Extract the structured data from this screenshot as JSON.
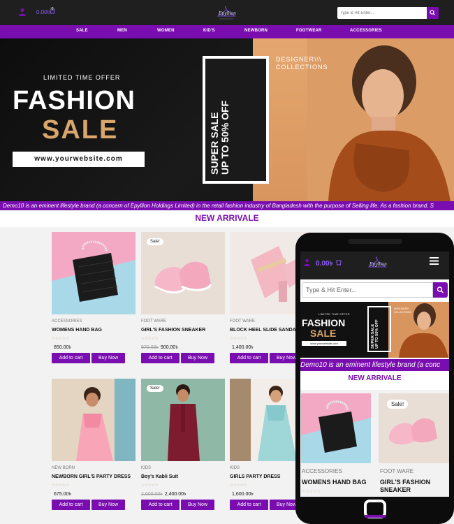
{
  "header": {
    "cart_amount": "0.00৳",
    "cart_count": "0",
    "search_placeholder": "Type & Hit Enter..."
  },
  "nav": {
    "items": [
      "SALE",
      "MEN",
      "WOMEN",
      "KID'S",
      "NEWBORN",
      "FOOTWEAR",
      "ACCESSORIES"
    ]
  },
  "hero": {
    "offer": "LIMITED TIME OFFER",
    "title1": "FASHION",
    "title2": "SALE",
    "url": "www.yourwebsite.com",
    "vertical_line1": "SUPER SALE",
    "vertical_line2": "UP TO 50% OFF",
    "designer_line1": "DESIGNER\\\\\\",
    "designer_line2": "COLLECTIONS"
  },
  "ticker": "Demo10 is an eminent lifestyle brand (a concern of Epyllion Holdings Limited) in the retail fashion industry of Bangladesh with the purpose of Selling life. As a fashion brand, S",
  "section_title": "NEW ARRIVALE",
  "products": [
    {
      "category": "ACCESSORIES",
      "name": "WOMENS HAND BAG",
      "stars": "☆☆☆☆☆",
      "old_price": "",
      "price": "850.00৳",
      "sale": "",
      "cart_label": "Add to cart",
      "buy_label": "Buy Now"
    },
    {
      "category": "FOOT WARE",
      "name": "GIRL'S FASHION SNEAKER",
      "stars": "☆☆☆☆☆",
      "old_price": "970.00৳",
      "price": "900.00৳",
      "sale": "Sale!",
      "cart_label": "Add to cart",
      "buy_label": "Buy Now"
    },
    {
      "category": "FOOT WARE",
      "name": "BLOCK HEEL SLIDE SANDAL",
      "stars": "☆☆☆☆☆",
      "old_price": "",
      "price": "1,400.00৳",
      "sale": "",
      "cart_label": "Add to cart",
      "buy_label": "Buy Now"
    },
    {
      "category": "NEW BORN",
      "name": "NEWBORN GIRL'S PARTY DRESS",
      "stars": "☆☆☆☆☆",
      "old_price": "",
      "price": "675.00৳",
      "sale": "",
      "cart_label": "Add to cart",
      "buy_label": "Buy Now"
    },
    {
      "category": "KIDS",
      "name": "Boy's Kabli Suit",
      "stars": "☆☆☆☆☆",
      "old_price": "2,600.00৳",
      "price": "2,400.00৳",
      "sale": "Sale!",
      "cart_label": "Add to cart",
      "buy_label": "Buy Now"
    },
    {
      "category": "KIDS",
      "name": "GIRLS PARTY DRESS",
      "stars": "☆☆☆☆☆",
      "old_price": "",
      "price": "1,600.00৳",
      "sale": "",
      "cart_label": "Add to cart",
      "buy_label": "Buy Now"
    }
  ],
  "mobile": {
    "cart_amount": "0.00৳",
    "search_placeholder": "Type & Hit Enter...",
    "ticker": "Demo10 is an eminent lifestyle brand (a conc",
    "section_title": "NEW ARRIVALE",
    "hero_offer": "LIMITED TIME OFFER",
    "hero_title1": "FASHION",
    "hero_title2": "SALE",
    "hero_url": "www.yourwebsite.com",
    "hero_vertical1": "SUPER SALE",
    "hero_vertical2": "UP TO 50% OFF",
    "hero_designer1": "DESIGNER\\\\\\",
    "hero_designer2": "COLLECTIONS",
    "card1": {
      "category": "ACCESSORIES",
      "name": "WOMENS HAND BAG",
      "stars": "☆☆☆☆☆"
    },
    "card2": {
      "category": "FOOT WARE",
      "name_line1": "GIRL'S FASHION",
      "name_line2": "SNEAKER",
      "sale": "Sale!"
    }
  },
  "colors": {
    "brand": "#7a0db0",
    "header_bg": "#1f1f1f"
  }
}
